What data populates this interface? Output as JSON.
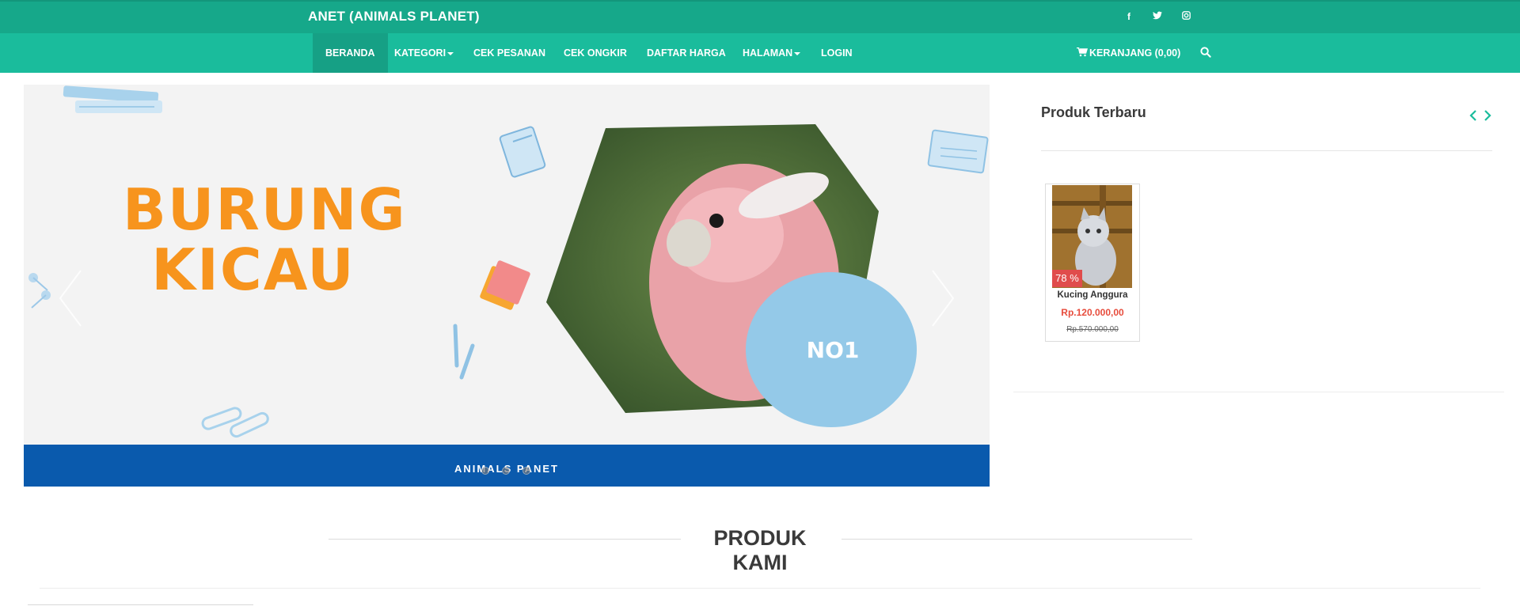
{
  "topbar": {
    "brand": "ANET (ANIMALS PLANET)",
    "social_icons": [
      "facebook-icon",
      "twitter-icon",
      "instagram-icon"
    ]
  },
  "nav": {
    "items": [
      {
        "label": "BERANDA",
        "active": true,
        "dropdown": false
      },
      {
        "label": "KATEGORI",
        "active": false,
        "dropdown": true
      },
      {
        "label": "CEK PESANAN",
        "active": false,
        "dropdown": false
      },
      {
        "label": "CEK ONGKIR",
        "active": false,
        "dropdown": false
      },
      {
        "label": "DAFTAR HARGA",
        "active": false,
        "dropdown": false
      },
      {
        "label": "HALAMAN",
        "active": false,
        "dropdown": true
      },
      {
        "label": "LOGIN",
        "active": false,
        "dropdown": false
      }
    ],
    "cart_label": "KERANJANG (0,00)",
    "search_icon": "search-icon"
  },
  "slider": {
    "title_line1": "BURUNG",
    "title_line2": "KICAU",
    "badge": "NO1",
    "footer_text": "ANIMALS PANET",
    "dot_count": 3,
    "active_dot": 1
  },
  "sidebar": {
    "title": "Produk Terbaru",
    "product": {
      "name": "Kucing Anggura",
      "price": "Rp.120.000,00",
      "old_price": "Rp.570.000,00",
      "discount": "78 %"
    }
  },
  "section": {
    "title": "PRODUK KAMI"
  },
  "colors": {
    "topbar": "#16a88a",
    "navbar": "#1abc9c",
    "accent_orange": "#f7941d",
    "footer_blue": "#0a5aad",
    "sale_red": "#e74c3c"
  }
}
